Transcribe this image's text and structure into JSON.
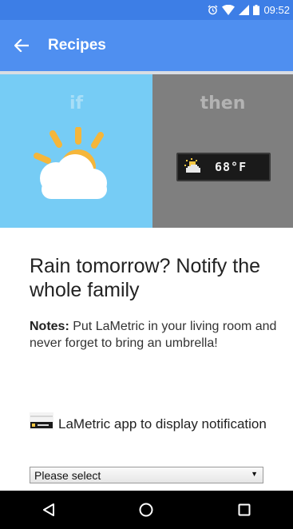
{
  "status_bar": {
    "time": "09:52",
    "icons": [
      "alarm-icon",
      "wifi-icon",
      "signal-icon",
      "battery-icon"
    ]
  },
  "app_bar": {
    "back_icon": "arrow-left-icon",
    "title": "Recipes"
  },
  "recipe_banner": {
    "if_label": "if",
    "then_label": "then",
    "if_icon": "sun-cloud-icon",
    "display_text": "68°F",
    "colors": {
      "if_bg": "#76ccf5",
      "then_bg": "#7f7f7f",
      "sun": "#f5b63a"
    }
  },
  "recipe": {
    "title": "Rain tomorrow? Notify the whole family",
    "notes_label": "Notes:",
    "notes_text": " Put LaMetric in your living room and never forget to bring an umbrella!"
  },
  "app_field": {
    "label": "LaMetric app to display notification",
    "select_value": "Please select"
  },
  "nav_bar": {
    "icons": [
      "back-triangle-icon",
      "home-circle-icon",
      "recents-square-icon"
    ]
  }
}
